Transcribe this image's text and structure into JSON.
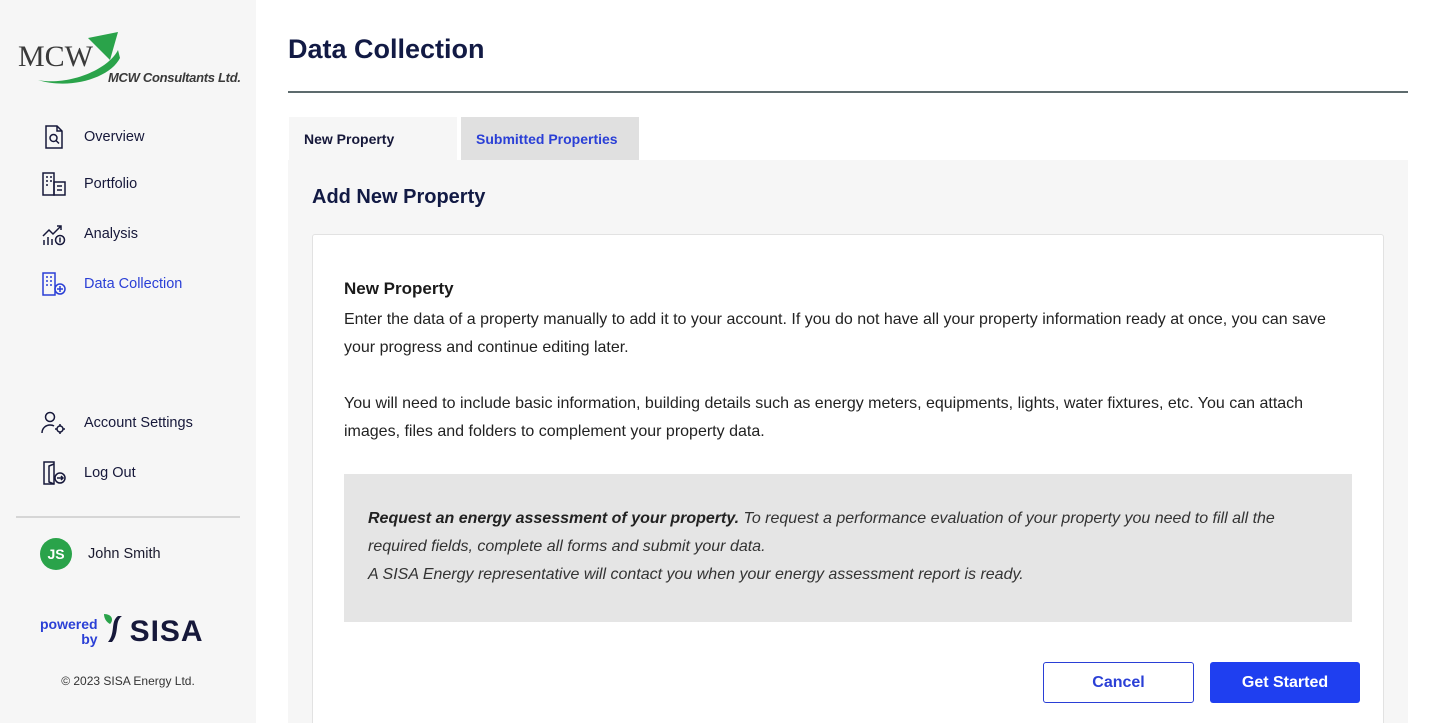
{
  "brand": {
    "logo_text": "MCW",
    "company_name": "MCW Consultants Ltd."
  },
  "sidebar": {
    "items": [
      {
        "label": "Overview",
        "icon": "report-search-icon"
      },
      {
        "label": "Portfolio",
        "icon": "buildings-portfolio-icon"
      },
      {
        "label": "Analysis",
        "icon": "chart-growth-icon"
      },
      {
        "label": "Data Collection",
        "icon": "building-add-icon",
        "active": true
      }
    ],
    "bottom_items": [
      {
        "label": "Account Settings",
        "icon": "user-gear-icon"
      },
      {
        "label": "Log Out",
        "icon": "logout-door-icon"
      }
    ],
    "user": {
      "initials": "JS",
      "name": "John Smith",
      "avatar_color": "#2aa34a"
    },
    "powered_by": {
      "line1": "powered",
      "line2": "by",
      "brand": "SISA"
    },
    "copyright": "© 2023 SISA Energy Ltd."
  },
  "page": {
    "title": "Data Collection",
    "tabs": [
      {
        "label": "New Property",
        "active": true
      },
      {
        "label": "Submitted Properties",
        "active": false
      }
    ],
    "panel_title": "Add New Property",
    "card": {
      "heading": "New Property",
      "paragraph1": "Enter the data of a property manually to add it to your account. If you do not have all your property information ready at once, you can save your progress and continue editing later.",
      "paragraph2": "You will need to include basic information, building details such as energy meters, equipments, lights, water fixtures, etc. You can attach images, files and folders to complement your property data.",
      "notice_bold": "Request an energy assessment of your property.",
      "notice_text": " To request a performance evaluation of your property you need to fill all the required fields, complete all forms and submit your data.",
      "notice_line2": "A SISA Energy representative will contact you when your energy assessment report is ready."
    },
    "buttons": {
      "cancel": "Cancel",
      "start": "Get Started"
    }
  },
  "colors": {
    "accent": "#2a3fd6",
    "primary_button": "#1f3ff0",
    "title": "#121a44",
    "sidebar_bg": "#f6f6f6",
    "avatar": "#2aa34a"
  }
}
